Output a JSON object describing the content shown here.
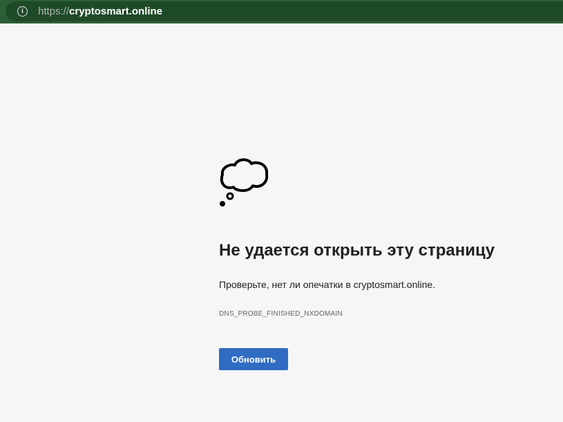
{
  "address_bar": {
    "scheme": "https://",
    "host": "cryptosmart.online",
    "icon": "info-icon"
  },
  "error": {
    "title": "Не удается открыть эту страницу",
    "message": "Проверьте, нет ли опечатки в cryptosmart.online.",
    "code": "DNS_PROBE_FINISHED_NXDOMAIN",
    "reload_label": "Обновить",
    "icon": "thought-cloud-icon"
  },
  "colors": {
    "accent": "#2f6cc2",
    "toolbar": "#2c5f36"
  }
}
